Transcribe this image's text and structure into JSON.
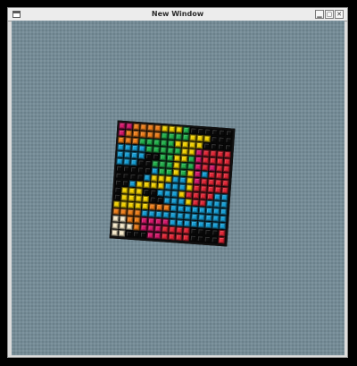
{
  "window": {
    "title": "New Window",
    "buttons": {
      "minimize": "▁",
      "maximize": "▢",
      "close": "✕"
    }
  },
  "board": {
    "rows": 16,
    "cols": 16,
    "palette": {
      "K": "#0c0c0c",
      "P": "#d6186c",
      "O": "#ef7f1a",
      "Y": "#f2d100",
      "G": "#22b24c",
      "B": "#169fd6",
      "R": "#e32636",
      "C": "#f4e8c9"
    },
    "grid": [
      "PPOOOOYYYGKKKKKK",
      "POOOOOGGGGYYYKKK",
      "OOOGGGGGYYYYKKKK",
      "BBBBGGGGGYYPRRRR",
      "BBBBKKGGYYGPRRRR",
      "BBBKKGGGYGGPRPRR",
      "KKKKKBGGYGYPBRRR",
      "KKKKBYYYBBYPRRRR",
      "KKBYYYYBBBYRRRRR",
      "KYYYKKBBBYRRRRBB",
      "KYYYYKKBBBYRRBBB",
      "YYYYYOOOBBBBBBBB",
      "OOOOBBBBBBBBBBBB",
      "CCOOPPPPBBBBBBBB",
      "CCCOPPPRRRRKKKKR",
      "CCKKKPPRRRRKKKKR"
    ]
  }
}
